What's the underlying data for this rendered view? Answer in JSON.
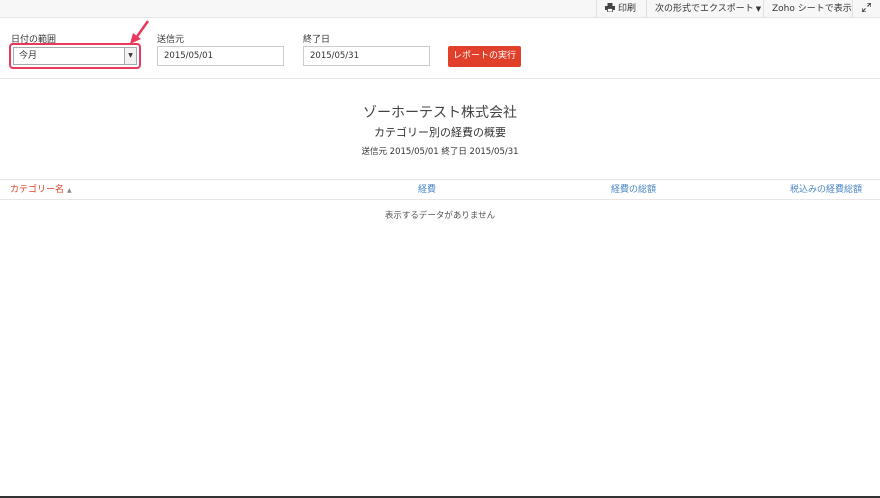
{
  "toolbar": {
    "print_label": "印刷",
    "print_icon": "printer-icon",
    "export_label": "次の形式でエクスポート",
    "sheet_label": "Zoho シートで表示",
    "expand_icon": "expand-icon"
  },
  "filters": {
    "date_range_label": "日付の範囲",
    "date_range_value": "今月",
    "from_label": "送信元",
    "from_value": "2015/05/01",
    "to_label": "終了日",
    "to_value": "2015/05/31",
    "run_button": "レポートの実行"
  },
  "report": {
    "company": "ゾーホーテスト株式会社",
    "title": "カテゴリー別の経費の概要",
    "range": "送信元 2015/05/01 終了日 2015/05/31"
  },
  "table": {
    "columns": [
      "カテゴリー名",
      "経費",
      "経費の総額",
      "税込みの経費総額"
    ],
    "empty_message": "表示するデータがありません"
  },
  "colors": {
    "accent": "#e0402a",
    "highlight": "#e8395d",
    "link": "#4a86c5"
  }
}
